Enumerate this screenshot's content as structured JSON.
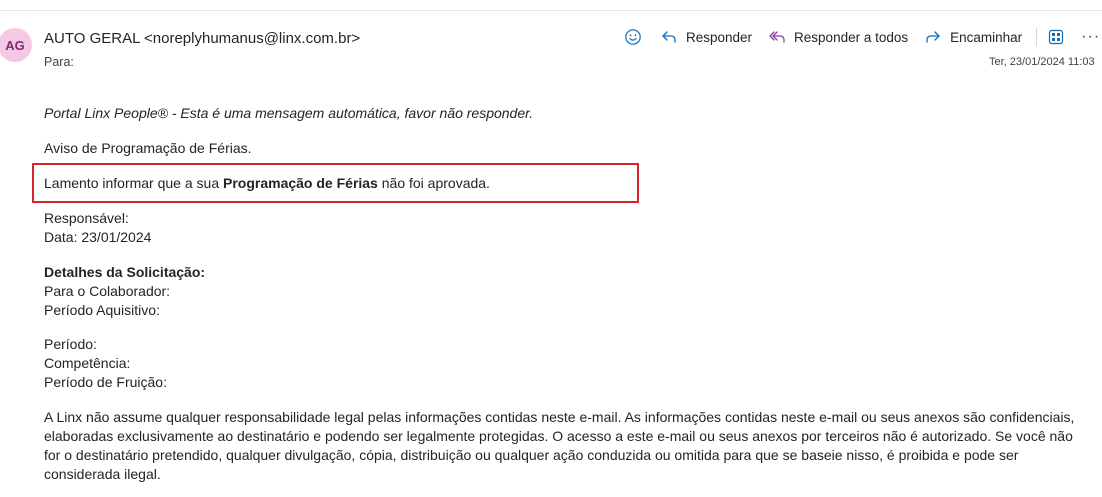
{
  "header": {
    "avatar_initials": "AG",
    "sender": "AUTO GERAL <noreplyhumanus@linx.com.br>",
    "to_label": "Para:",
    "timestamp": "Ter, 23/01/2024 11:03",
    "actions": {
      "emoji_icon": "smiley-icon",
      "reply_label": "Responder",
      "reply_all_label": "Responder a todos",
      "forward_label": "Encaminhar",
      "apps_icon": "apps-grid-icon",
      "more_label": "···"
    }
  },
  "email": {
    "intro": "Portal Linx People® - Esta é uma mensagem automática, favor não responder.",
    "notice": "Aviso de Programação de Férias.",
    "message_prefix": "Lamento informar que a sua ",
    "message_bold": "Programação de Férias",
    "message_suffix": " não foi aprovada.",
    "responsavel": "Responsável:",
    "data": "Data: 23/01/2024",
    "details_title": "Detalhes da Solicitação:",
    "colaborador": "Para o Colaborador:",
    "periodo_aquisitivo": "Período Aquisitivo:",
    "periodo": "Período:",
    "competencia": "Competência:",
    "periodo_fruicao": "Período de Fruição:",
    "legal": "A Linx não assume qualquer responsabilidade legal pelas informações contidas neste e-mail. As informações contidas neste e-mail ou seus anexos são confidenciais, elaboradas exclusivamente ao destinatário e podendo ser legalmente protegidas. O acesso a este e-mail ou seus anexos por terceiros não é autorizado. Se você não for o destinatário pretendido, qualquer divulgação, cópia, distribuição ou qualquer ação conduzida ou omitida para que se baseie nisso, é proibida e pode ser considerada ilegal."
  },
  "colors": {
    "highlight_border": "#d7262f",
    "avatar_bg": "#f6c8e8",
    "accent": "#0f6cbd"
  }
}
